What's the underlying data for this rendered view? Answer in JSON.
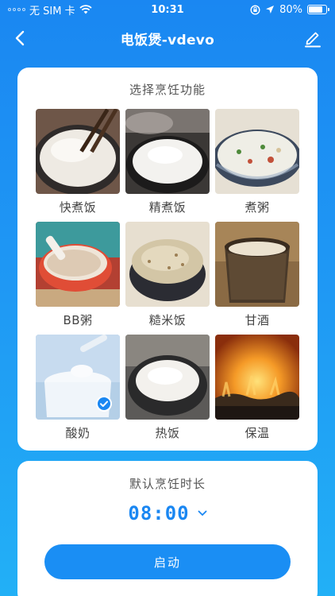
{
  "status_bar": {
    "carrier": "无 SIM 卡",
    "time": "10:31",
    "battery_text": "80%",
    "battery_level": 0.8
  },
  "nav": {
    "title": "电饭煲-vdevo",
    "back_icon": "chevron-left-icon",
    "edit_icon": "pencil-icon"
  },
  "functions": {
    "title": "选择烹饪功能",
    "items": [
      {
        "label": "快煮饭",
        "selected": false
      },
      {
        "label": "精煮饭",
        "selected": false
      },
      {
        "label": "煮粥",
        "selected": false
      },
      {
        "label": "BB粥",
        "selected": false
      },
      {
        "label": "糙米饭",
        "selected": false
      },
      {
        "label": "甘酒",
        "selected": false
      },
      {
        "label": "酸奶",
        "selected": true
      },
      {
        "label": "热饭",
        "selected": false
      },
      {
        "label": "保温",
        "selected": false
      }
    ]
  },
  "duration": {
    "title": "默认烹饪时长",
    "time": "08:00",
    "start_label": "启动"
  },
  "colors": {
    "accent": "#1a87f2",
    "background_top": "#1a87f2",
    "background_bottom": "#22b0f6"
  }
}
